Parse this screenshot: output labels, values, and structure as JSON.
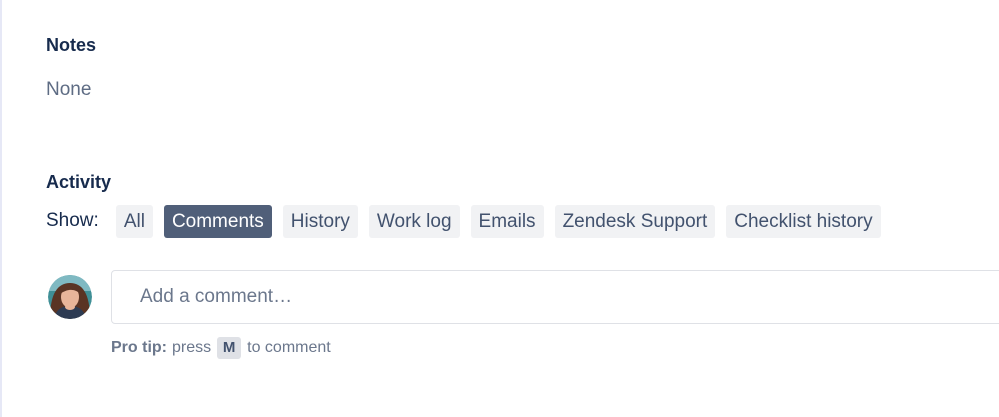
{
  "notes": {
    "heading": "Notes",
    "value": "None"
  },
  "activity": {
    "heading": "Activity",
    "show_label": "Show:",
    "filters": [
      {
        "label": "All",
        "active": false
      },
      {
        "label": "Comments",
        "active": true
      },
      {
        "label": "History",
        "active": false
      },
      {
        "label": "Work log",
        "active": false
      },
      {
        "label": "Emails",
        "active": false
      },
      {
        "label": "Zendesk Support",
        "active": false
      },
      {
        "label": "Checklist history",
        "active": false
      }
    ]
  },
  "comment": {
    "placeholder": "Add a comment…",
    "avatar_icon": "user-avatar-photo"
  },
  "pro_tip": {
    "label": "Pro tip:",
    "before_key": "press",
    "key": "M",
    "after_key": "to comment"
  },
  "colors": {
    "heading_text": "#172b4d",
    "muted_text": "#5e6c84",
    "filter_bg": "#f1f2f4",
    "filter_active_bg": "#505f79",
    "filter_text": "#42526e"
  }
}
